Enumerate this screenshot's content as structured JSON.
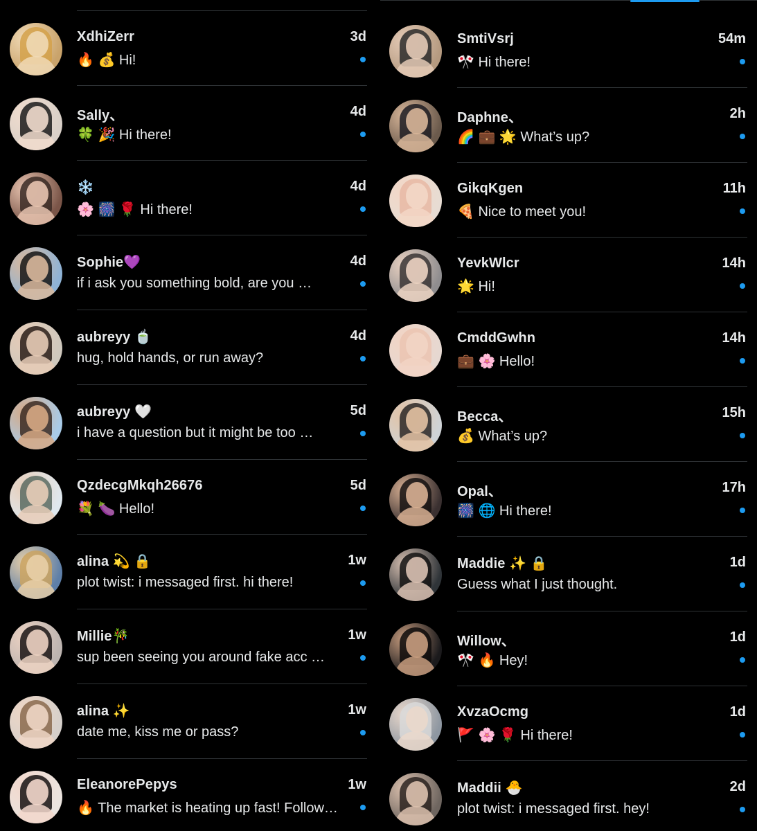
{
  "accent_color": "#1d9bf0",
  "left": [
    {
      "name": "XdhiZerr",
      "preview": "🔥 💰 Hi!",
      "time": "3d",
      "avatar_colors": [
        "#c9a36b",
        "#f0d9b5",
        "#d4a14a"
      ]
    },
    {
      "name": "Sally、",
      "preview": "🍀 🎉 Hi there!",
      "time": "4d",
      "avatar_colors": [
        "#d9d0c8",
        "#f1dccd",
        "#1b1b1b"
      ]
    },
    {
      "name": "❄️",
      "preview": "🌸 🎆 🌹 Hi there!",
      "time": "4d",
      "avatar_colors": [
        "#7a5548",
        "#e8c4b0",
        "#3a2a24"
      ]
    },
    {
      "name": "Sophie💜",
      "preview": "if i ask you something bold, are you …",
      "time": "4d",
      "avatar_colors": [
        "#8fb3d6",
        "#d9b89c",
        "#151515"
      ]
    },
    {
      "name": "aubreyy 🍵",
      "preview": "hug, hold hands, or run away?",
      "time": "4d",
      "avatar_colors": [
        "#cfc8bd",
        "#e6cbb6",
        "#2a1d18"
      ]
    },
    {
      "name": "aubreyy 🤍",
      "preview": "i have a question but it might be too …",
      "time": "5d",
      "avatar_colors": [
        "#a9cbe8",
        "#d6a884",
        "#3b2a22"
      ]
    },
    {
      "name": "QzdecgMkqh26676",
      "preview": "💐 🍆 Hello!",
      "time": "5d",
      "avatar_colors": [
        "#dfe8ee",
        "#e7cdb8",
        "#5a6b62"
      ]
    },
    {
      "name": "alina 💫 🔒",
      "preview": "plot twist: i messaged first. hi there!",
      "time": "1w",
      "avatar_colors": [
        "#5e7fa8",
        "#e8cfa8",
        "#caa361"
      ]
    },
    {
      "name": "Millie🎋",
      "preview": "sup been seeing you around fake acc …",
      "time": "1w",
      "avatar_colors": [
        "#bdb4b0",
        "#ecd2c2",
        "#1a1414"
      ]
    },
    {
      "name": "alina ✨",
      "preview": "date me, kiss me or pass?",
      "time": "1w",
      "avatar_colors": [
        "#d6d0cb",
        "#eed6c5",
        "#8a6a4e"
      ]
    },
    {
      "name": "EleanorePepys",
      "preview": "🔥 The market is heating up fast! Follow…",
      "time": "1w",
      "avatar_colors": [
        "#ebe4df",
        "#f2d7cb",
        "#161212"
      ]
    }
  ],
  "right": [
    {
      "name": "SmtiVsrj",
      "preview": "🎌 Hi there!",
      "time": "54m",
      "avatar_colors": [
        "#b59a80",
        "#e4cab6",
        "#2b2b2b"
      ]
    },
    {
      "name": "Daphne、",
      "preview": "🌈 💼 🌟 What’s up?",
      "time": "2h",
      "avatar_colors": [
        "#6b5a4c",
        "#d8b699",
        "#1d1c22"
      ]
    },
    {
      "name": "GikqKgen",
      "preview": "🍕 Nice to meet you!",
      "time": "11h",
      "avatar_colors": [
        "#e7dcd3",
        "#f3d7c6",
        "#e8b9a4"
      ]
    },
    {
      "name": "YevkWlcr",
      "preview": "🌟 Hi!",
      "time": "14h",
      "avatar_colors": [
        "#8f8d8f",
        "#ecd3c2",
        "#3a3535"
      ]
    },
    {
      "name": "CmddGwhn",
      "preview": "💼 🌸 Hello!",
      "time": "14h",
      "avatar_colors": [
        "#e6d8d1",
        "#f2d4c4",
        "#ebc4b2"
      ]
    },
    {
      "name": "Becca、",
      "preview": "💰 What’s up?",
      "time": "15h",
      "avatar_colors": [
        "#cfd3d6",
        "#e3c2a3",
        "#2a2726"
      ]
    },
    {
      "name": "Opal、",
      "preview": "🎆 🌐 Hi there!",
      "time": "17h",
      "avatar_colors": [
        "#3a3030",
        "#d8b093",
        "#151212"
      ]
    },
    {
      "name": "Maddie ✨ 🔒",
      "preview": "Guess what I just thought.",
      "time": "1d",
      "avatar_colors": [
        "#2f3438",
        "#d9c1b2",
        "#121212"
      ]
    },
    {
      "name": "Willow、",
      "preview": "🎌 🔥 Hey!",
      "time": "1d",
      "avatar_colors": [
        "#1b1a1c",
        "#c89d7f",
        "#0d0b0b"
      ]
    },
    {
      "name": "XvzaOcmg",
      "preview": "🚩 🌸 🌹 Hi there!",
      "time": "1d",
      "avatar_colors": [
        "#8e97a1",
        "#ead8cb",
        "#d9d9d9"
      ]
    },
    {
      "name": "Maddii 🐣",
      "preview": "plot twist: i messaged first. hey!",
      "time": "2d",
      "avatar_colors": [
        "#6e655f",
        "#dcc1ae",
        "#2b2320"
      ]
    }
  ]
}
